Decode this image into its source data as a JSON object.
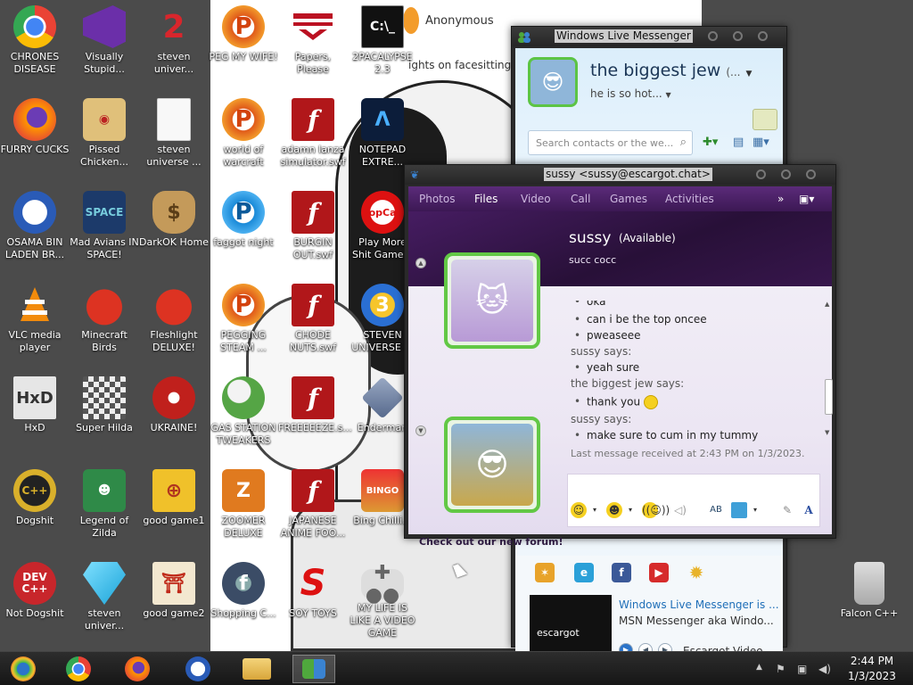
{
  "desktop": {
    "icons": [
      {
        "label": "CHRONES DISEASE",
        "icon": "chrome-icon"
      },
      {
        "label": "Visually Stupid...",
        "icon": "visual-studio-icon"
      },
      {
        "label": "steven univer...",
        "icon": "number-two-icon"
      },
      {
        "label": "FURRY CUCKS",
        "icon": "firefox-icon"
      },
      {
        "label": "Pissed Chicken...",
        "icon": "angry-birds-seasons-icon"
      },
      {
        "label": "steven universe ...",
        "icon": "blank-file-icon"
      },
      {
        "label": "OSAMA BIN LADEN BR...",
        "icon": "obama-logo-icon"
      },
      {
        "label": "Mad Avians IN SPACE!",
        "icon": "angry-birds-space-icon"
      },
      {
        "label": "DarkOK Home",
        "icon": "money-bag-icon"
      },
      {
        "label": "VLC media player",
        "icon": "vlc-cone-icon"
      },
      {
        "label": "Minecraft Birds",
        "icon": "red-bird-icon"
      },
      {
        "label": "Fleshlight DELUXE!",
        "icon": "red-puffball-icon"
      },
      {
        "label": "HxD",
        "icon": "hxd-icon"
      },
      {
        "label": "Super Hilda",
        "icon": "pixel-cat-icon"
      },
      {
        "label": "UKRAINE!",
        "icon": "radiation-icon"
      },
      {
        "label": "Dogshit",
        "icon": "dogshit-cpp-icon"
      },
      {
        "label": "Legend of Zilda",
        "icon": "pixel-hero-icon"
      },
      {
        "label": "good game1",
        "icon": "mahjong-tile-icon"
      },
      {
        "label": "Not Dogshit",
        "icon": "dev-cpp-icon"
      },
      {
        "label": "steven univer...",
        "icon": "diamond-icon"
      },
      {
        "label": "good game2",
        "icon": "torii-tile-icon"
      },
      {
        "label": "PEG MY WIFE!",
        "icon": "peggle-icon"
      },
      {
        "label": "Papers, Please",
        "icon": "arstotzka-eagle-icon"
      },
      {
        "label": "2PACALYPSE 2.3",
        "icon": "cmd-icon"
      },
      {
        "label": "world of warcraft",
        "icon": "peggle-icon"
      },
      {
        "label": "adamn lanza simulator.swf",
        "icon": "flash-icon"
      },
      {
        "label": "NOTEPAD EXTRE...",
        "icon": "notepad-icon"
      },
      {
        "label": "faggot night",
        "icon": "peggle-nights-icon"
      },
      {
        "label": "BURGIN OUT.swf",
        "icon": "flash-icon"
      },
      {
        "label": "Play More Shit Game...",
        "icon": "popcap-icon"
      },
      {
        "label": "PEGGING STEAM ...",
        "icon": "peggle-icon"
      },
      {
        "label": "CHODE NUTS.swf",
        "icon": "flash-icon"
      },
      {
        "label": "STEVEN UNIVERSE ...",
        "icon": "number-three-icon"
      },
      {
        "label": "GAS STATION TWEAKERS",
        "icon": "plant-icon"
      },
      {
        "label": "FREEEEEZE.s...",
        "icon": "flash-icon"
      },
      {
        "label": "Enderman",
        "icon": "cube-icon"
      },
      {
        "label": "ZOOMER DELUXE",
        "icon": "zuma-icon"
      },
      {
        "label": "JAPANESE ANIME FOO...",
        "icon": "flash-icon"
      },
      {
        "label": "Bing Chilli...",
        "icon": "bingo-icon"
      },
      {
        "label": "Shopping C...",
        "icon": "flash-player-icon"
      },
      {
        "label": "SOY TOYS",
        "icon": "red-s-icon"
      },
      {
        "label": "MY LIFE IS LIKE A VIDEO GAME",
        "icon": "gamepad-icon"
      },
      {
        "label": "Falcon C++",
        "icon": "recycle-bin-icon"
      }
    ],
    "post": {
      "name": "Anonymous",
      "text": "ights on facesitting"
    }
  },
  "messenger": {
    "title": "Windows Live Messenger",
    "display_name": "the biggest jew",
    "display_name_suffix": "(...",
    "personal_message": "he is so hot...",
    "search_placeholder": "Search contacts or the we...",
    "news": {
      "title": "Windows Live Messenger is ...",
      "subtitle": "MSN Messenger aka Windo...",
      "video_label": "Escargot Video",
      "thumb_label": "escargot"
    }
  },
  "chat": {
    "title": "sussy <sussy@escargot.chat>",
    "tabs": [
      "Photos",
      "Files",
      "Video",
      "Call",
      "Games",
      "Activities"
    ],
    "more": "»",
    "contact": {
      "name": "sussy",
      "status": "(Available)",
      "message": "succ cocc"
    },
    "conversation": {
      "partial": "oka",
      "lines": [
        {
          "type": "msg",
          "text": "can i be the top oncee"
        },
        {
          "type": "msg",
          "text": "pweaseee"
        },
        {
          "type": "says",
          "text": "sussy says:"
        },
        {
          "type": "msg",
          "text": "yeah sure"
        },
        {
          "type": "says",
          "text": "the biggest jew says:"
        },
        {
          "type": "msg",
          "text": "thank you"
        },
        {
          "type": "says",
          "text": "sussy says:"
        },
        {
          "type": "msg",
          "text": "make sure to cum in my tummy"
        }
      ]
    },
    "last_message": "Last message received at 2:43 PM on 1/3/2023.",
    "forum_link": "Check out our new forum!"
  },
  "taskbar": {
    "time": "2:44 PM",
    "date": "1/3/2023",
    "apps": [
      "start-orb-icon",
      "chrome-icon",
      "firefox-icon",
      "obama-logo-icon",
      "file-explorer-icon",
      "messenger-icon"
    ]
  }
}
